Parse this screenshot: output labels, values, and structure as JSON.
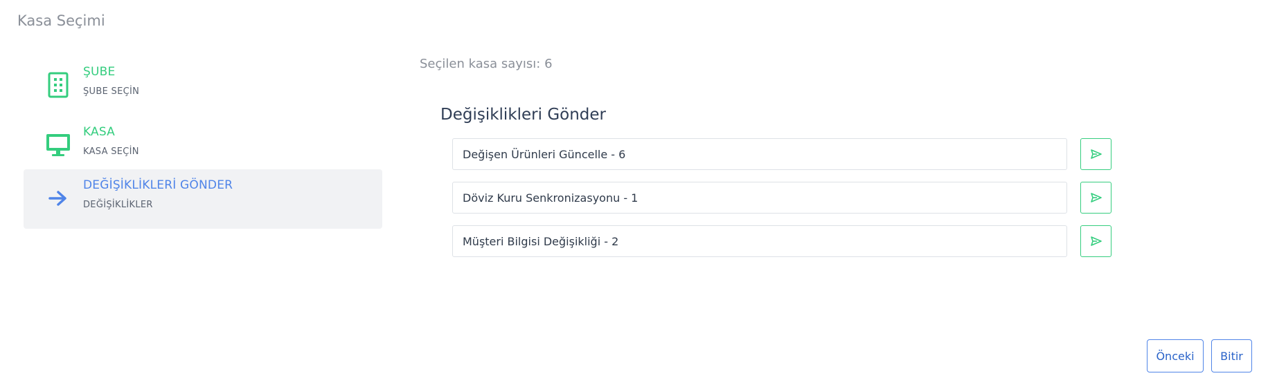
{
  "page": {
    "title": "Kasa Seçimi"
  },
  "steps": [
    {
      "title": "ŞUBE",
      "subtitle": "ŞUBE SEÇİN",
      "icon": "building-icon",
      "color": "#34cd7e"
    },
    {
      "title": "KASA",
      "subtitle": "KASA SEÇİN",
      "icon": "monitor-icon",
      "color": "#34cd7e"
    },
    {
      "title": "DEĞİŞİKLİKLERİ GÖNDER",
      "subtitle": "DEĞİŞİKLİKLER",
      "icon": "arrow-right-icon",
      "color": "#4f84e8",
      "active": true
    }
  ],
  "main": {
    "selected_count_text": "Seçilen kasa sayısı: 6",
    "section_title": "Değişiklikleri Gönder",
    "changes": [
      {
        "label": "Değişen Ürünleri Güncelle - 6",
        "action_icon": "send-icon"
      },
      {
        "label": "Döviz Kuru Senkronizasyonu - 1",
        "action_icon": "send-icon"
      },
      {
        "label": "Müşteri Bilgisi Değişikliği - 2",
        "action_icon": "send-icon"
      }
    ]
  },
  "footer": {
    "previous_label": "Önceki",
    "finish_label": "Bitir"
  },
  "colors": {
    "accent_green": "#34cd7e",
    "accent_blue": "#4f84e8",
    "active_step_bg": "#f1f2f4"
  }
}
